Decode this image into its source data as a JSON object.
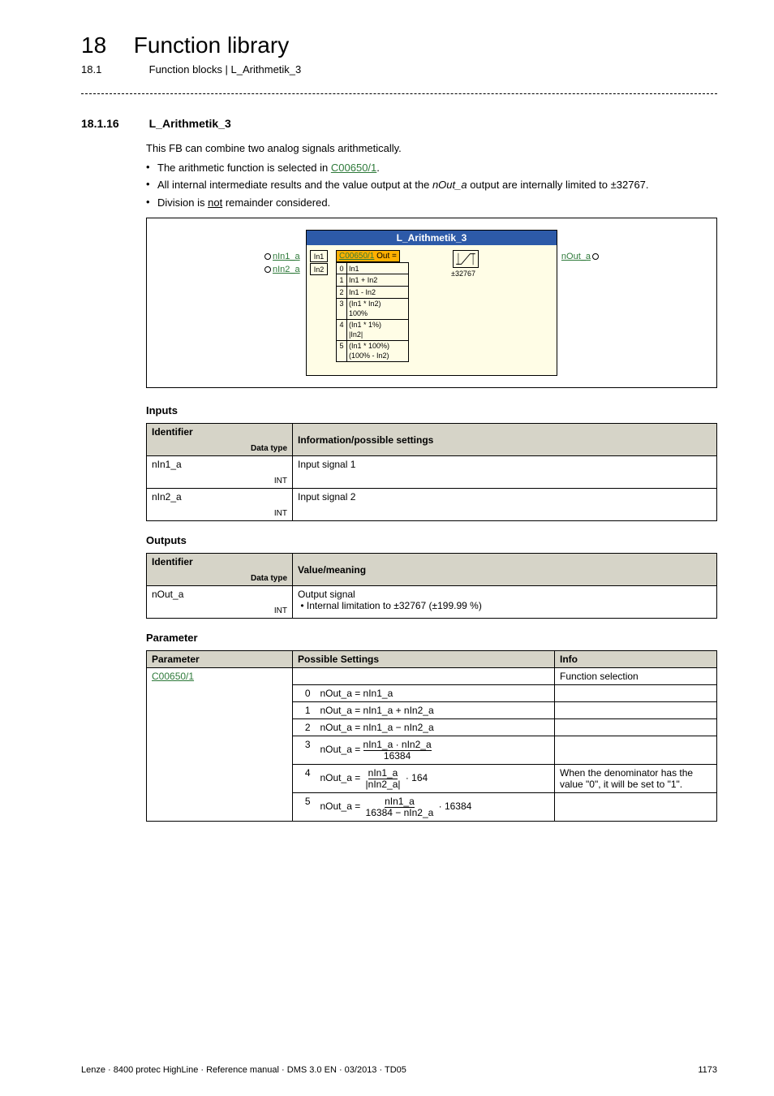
{
  "header": {
    "chapter_num": "18",
    "chapter_title": "Function library",
    "section_num": "18.1",
    "section_title": "Function blocks | L_Arithmetik_3"
  },
  "subsection": {
    "num": "18.1.16",
    "title": "L_Arithmetik_3"
  },
  "intro": {
    "para1": "This FB can combine two analog signals arithmetically.",
    "b1_pre": "The arithmetic function is selected in ",
    "b1_link": "C00650/1",
    "b1_post": ".",
    "b2_pre": "All internal intermediate results and the value output at the ",
    "b2_italic": "nOut_a",
    "b2_post": " output are internally limited to ±32767.",
    "b3_pre": "Division is ",
    "b3_under": "not",
    "b3_post": " remainder considered."
  },
  "diagram": {
    "title": "L_Arithmetik_3",
    "in1": "nIn1_a",
    "in2": "nIn2_a",
    "in1lbl": "In1",
    "in2lbl": "In2",
    "out": "nOut_a",
    "code": "C00650/1",
    "code_suffix": " Out =",
    "limit": "±32767",
    "opts": [
      {
        "i": "0",
        "v": "In1"
      },
      {
        "i": "1",
        "v": "In1 + In2"
      },
      {
        "i": "2",
        "v": "In1 - In2"
      },
      {
        "i": "3",
        "v": "(In1 * In2)\n100%"
      },
      {
        "i": "4",
        "v": "(In1 * 1%)\n|In2|"
      },
      {
        "i": "5",
        "v": "(In1 * 100%)\n(100% - In2)"
      }
    ]
  },
  "inputs": {
    "heading": "Inputs",
    "h1": "Identifier",
    "h1sub": "Data type",
    "h2": "Information/possible settings",
    "rows": [
      {
        "id": "nIn1_a",
        "dt": "INT",
        "desc": "Input signal 1"
      },
      {
        "id": "nIn2_a",
        "dt": "INT",
        "desc": "Input signal 2"
      }
    ]
  },
  "outputs": {
    "heading": "Outputs",
    "h1": "Identifier",
    "h1sub": "Data type",
    "h2": "Value/meaning",
    "rows": [
      {
        "id": "nOut_a",
        "dt": "INT",
        "desc": "Output signal",
        "sub": "Internal limitation to ±32767 (±199.99 %)"
      }
    ]
  },
  "params": {
    "heading": "Parameter",
    "h1": "Parameter",
    "h2": "Possible Settings",
    "h3": "Info",
    "paramlink": "C00650/1",
    "info0": "Function selection",
    "rows": [
      {
        "n": "0",
        "f_text": "nOut_a = nIn1_a",
        "info": ""
      },
      {
        "n": "1",
        "f_text": "nOut_a = nIn1_a + nIn2_a",
        "info": ""
      },
      {
        "n": "2",
        "f_text": "nOut_a = nIn1_a − nIn2_a",
        "info": ""
      },
      {
        "n": "3",
        "f_pre": "nOut_a = ",
        "f_num": "nIn1_a · nIn2_a",
        "f_den": "16384",
        "f_post": "",
        "info": ""
      },
      {
        "n": "4",
        "f_pre": "nOut_a = ",
        "f_num": "nIn1_a",
        "f_den": "|nIn2_a|",
        "f_post": " · 164",
        "info": "When the denominator has the value \"0\", it will be set to \"1\"."
      },
      {
        "n": "5",
        "f_pre": "nOut_a = ",
        "f_num": "nIn1_a",
        "f_den": "16384 − nIn2_a",
        "f_post": " · 16384",
        "info": ""
      }
    ]
  },
  "footer": {
    "left": "Lenze · 8400 protec HighLine · Reference manual · DMS 3.0 EN · 03/2013 · TD05",
    "right": "1173"
  }
}
